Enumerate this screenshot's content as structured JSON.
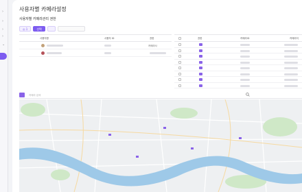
{
  "page": {
    "title": "사용자별 카메라설정",
    "subtitle": "사용자별 카메라관리 권한"
  },
  "toolbar": {
    "chips": [
      {
        "label": "1",
        "state": "tab"
      },
      {
        "label": "선택",
        "state": "active"
      },
      {
        "label": "",
        "state": "tab"
      },
      {
        "label": "",
        "state": "search"
      }
    ]
  },
  "users_table": {
    "columns": [
      "사용자명",
      "사용자 ID",
      "권한"
    ],
    "rows": [
      {
        "role": "카메라사"
      },
      {
        "role": ""
      }
    ]
  },
  "camera_table": {
    "columns": [
      "",
      "권한",
      "카메라ID",
      "카메라이"
    ],
    "row_count": 8
  },
  "map": {
    "search_placeholder": "카메라 검색",
    "colors": {
      "river": "#9ec9e8",
      "park": "#cfe8c7",
      "road": "#ffffff",
      "land": "#eef0f2",
      "accent": "#7d5cf0"
    }
  },
  "rail_icons": [
    "chevron-right-icon",
    "chevron-right-icon",
    "chevron-right-icon",
    "chevron-right-icon",
    "chevron-down-icon"
  ]
}
